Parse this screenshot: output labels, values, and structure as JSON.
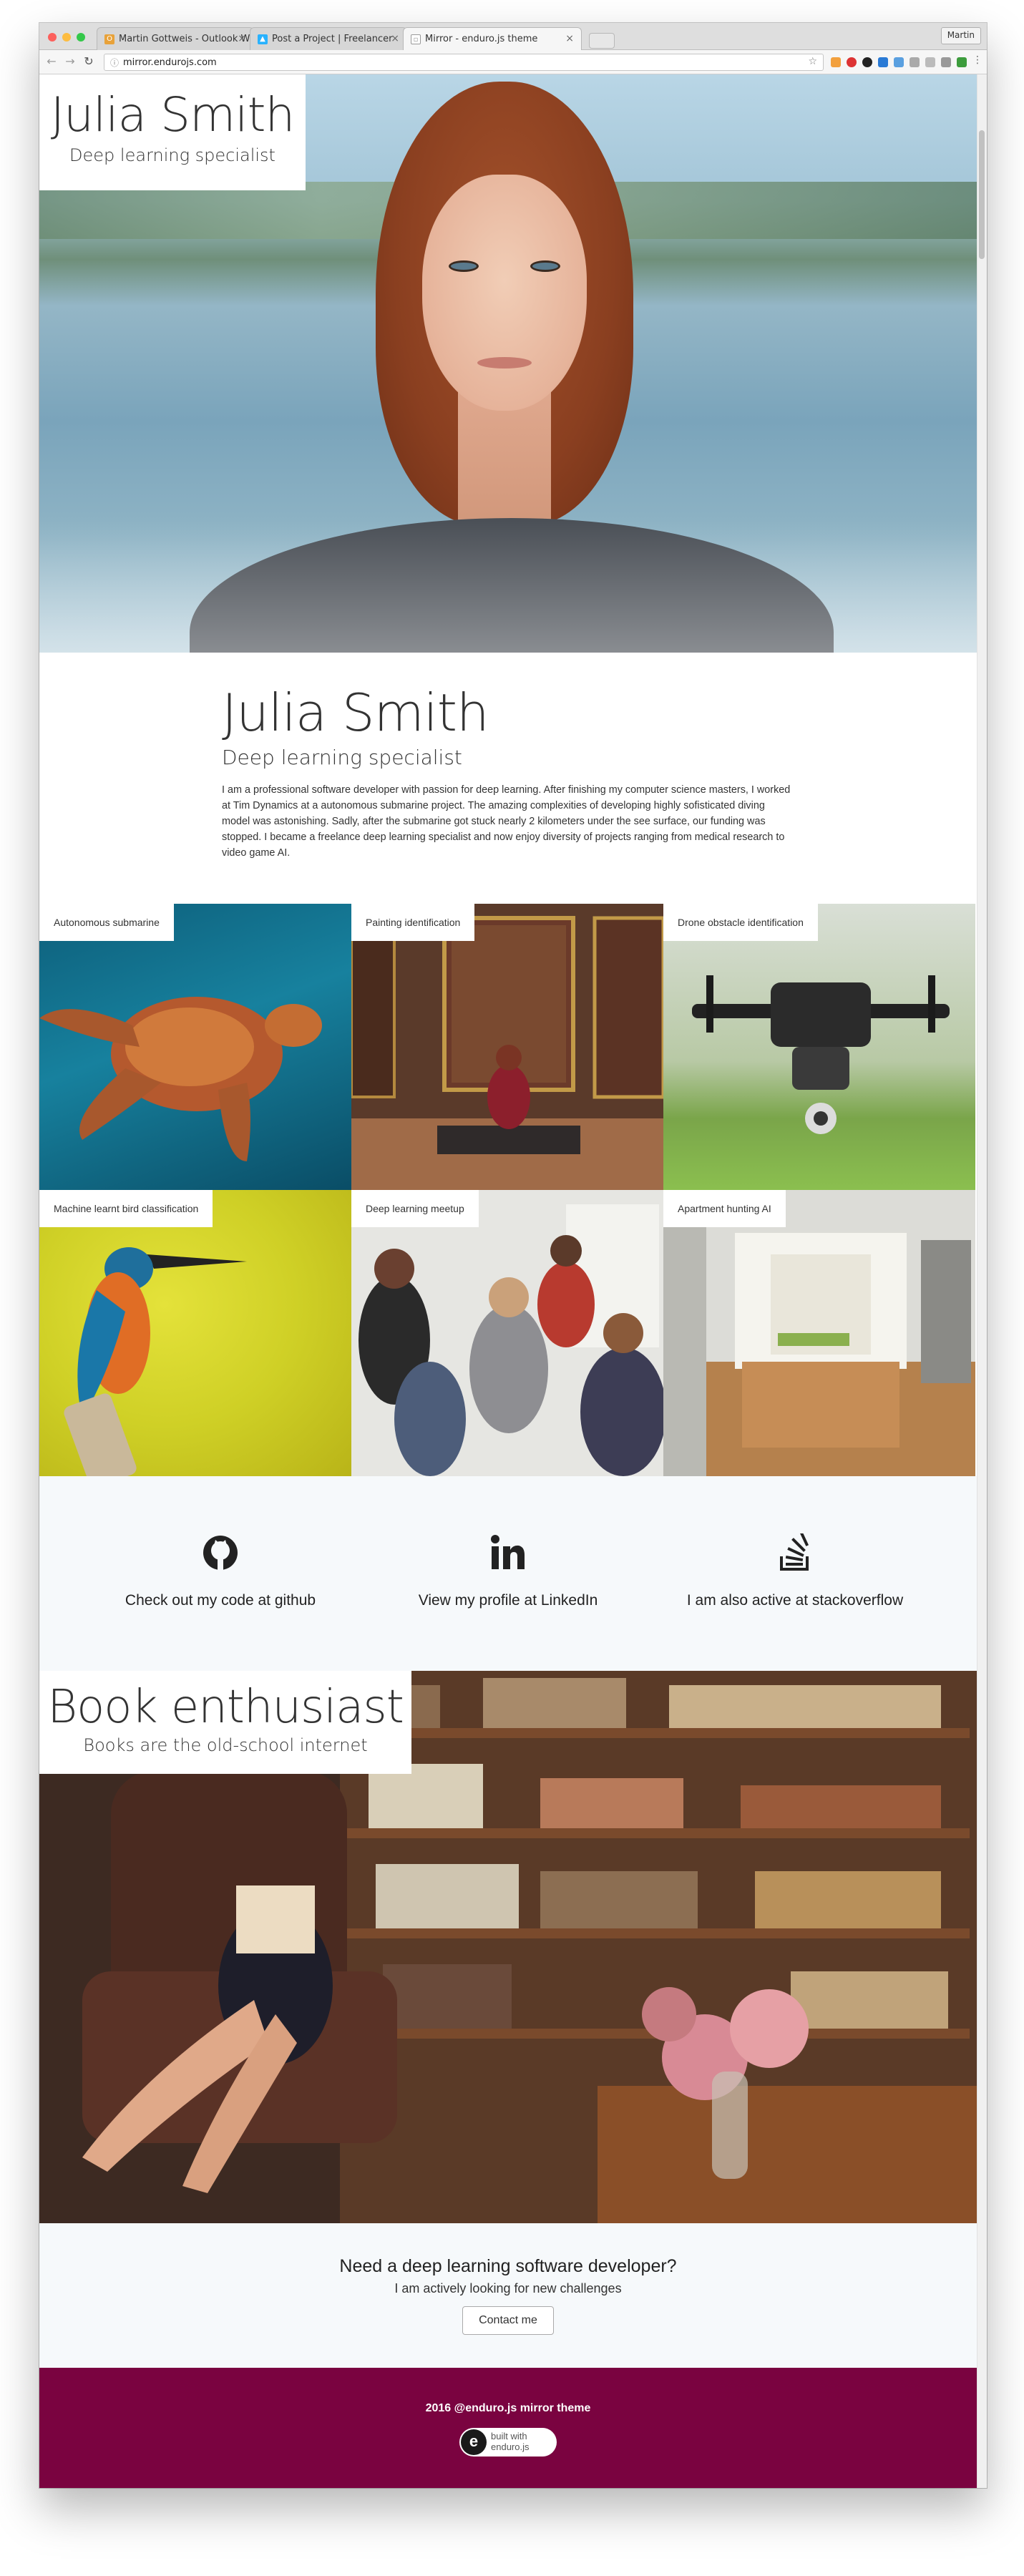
{
  "browser": {
    "tabs": [
      {
        "label": "Martin Gottweis - Outlook We",
        "icon": "outlook-icon",
        "color": "#e8a23a"
      },
      {
        "label": "Post a Project | Freelancer",
        "icon": "freelancer-icon",
        "color": "#29b2fe"
      },
      {
        "label": "Mirror - enduro.js theme",
        "icon": "page-icon",
        "color": "#9a9a9a"
      }
    ],
    "profile": "Martin",
    "url": "mirror.endurojs.com"
  },
  "hero": {
    "name": "Julia Smith",
    "subtitle": "Deep learning specialist"
  },
  "intro": {
    "name": "Julia Smith",
    "subtitle": "Deep learning specialist",
    "body": "I am a professional software developer with passion for deep learning. After finishing my computer science masters, I worked at Tim Dynamics at a autonomous submarine project. The amazing complexities of developing highly sofisticated diving model was astonishing. Sadly, after the submarine got stuck nearly 2 kilometers under the see surface, our funding was stopped. I became a freelance deep learning specialist and now enjoy diversity of projects ranging from medical research to video game AI."
  },
  "gallery": [
    {
      "label": "Autonomous submarine"
    },
    {
      "label": "Painting identification"
    },
    {
      "label": "Drone obstacle identification"
    },
    {
      "label": "Machine learnt bird classification"
    },
    {
      "label": "Deep learning meetup"
    },
    {
      "label": "Apartment hunting AI"
    }
  ],
  "links": [
    {
      "text": "Check out my code at github",
      "icon": "github-icon"
    },
    {
      "text": "View my profile at LinkedIn",
      "icon": "linkedin-icon"
    },
    {
      "text": "I am also active at stackoverflow",
      "icon": "stackoverflow-icon"
    }
  ],
  "books": {
    "title": "Book enthusiast",
    "subtitle": "Books are the old-school internet"
  },
  "cta": {
    "title": "Need a deep learning software developer?",
    "subtitle": "I am actively looking for new challenges",
    "button": "Contact me"
  },
  "footer": {
    "text": "2016 @enduro.js mirror theme",
    "badge_line1": "built with",
    "badge_line2": "enduro.js",
    "badge_letter": "e",
    "color": "#7a0340"
  }
}
